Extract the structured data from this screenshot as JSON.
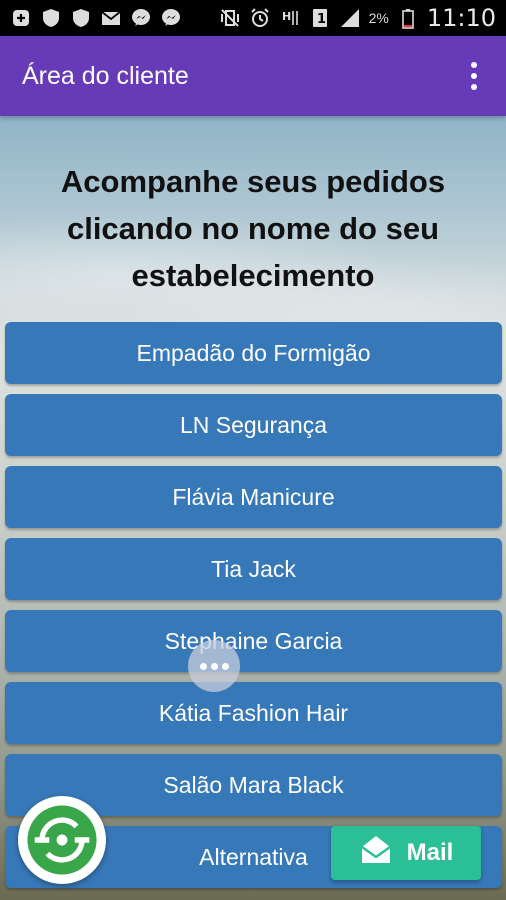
{
  "status_bar": {
    "battery_percent": "2%",
    "time": "11:10",
    "icons": [
      "add-icon",
      "shield-icon",
      "shield-icon",
      "mail-icon",
      "messenger-icon",
      "messenger-icon",
      "vibrate-off-icon",
      "alarm-icon",
      "data-h-icon",
      "sim-1-icon",
      "signal-icon",
      "battery-icon"
    ]
  },
  "app_bar": {
    "title": "Área do cliente",
    "menu_icon": "overflow-menu-icon"
  },
  "main": {
    "heading": "Acompanhe seus pedidos clicando no nome do seu estabelecimento",
    "stores": [
      {
        "label": "Empadão do Formigão"
      },
      {
        "label": "LN Segurança"
      },
      {
        "label": "Flávia Manicure"
      },
      {
        "label": "Tia Jack"
      },
      {
        "label": "Stephaine Garcia"
      },
      {
        "label": "Kátia Fashion Hair"
      },
      {
        "label": "Salão Mara Black"
      },
      {
        "label": "Alternativa"
      }
    ]
  },
  "floating": {
    "chat_icon": "chat-bubble-icon",
    "logo_icon": "app-logo-icon",
    "mail_label": "Mail",
    "mail_icon": "mail-icon",
    "accent_color": "#2bbf98",
    "logo_color": "#3aa64a"
  },
  "colors": {
    "app_bar": "#673ab7",
    "button": "#3778b9"
  }
}
